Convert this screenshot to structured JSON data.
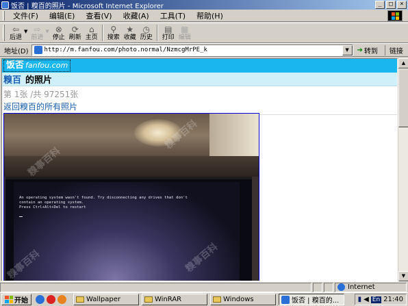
{
  "window": {
    "title": "饭否 | 糗百的照片 - Microsoft Internet Explorer",
    "minimize": "_",
    "maximize": "□",
    "close": "×"
  },
  "menu": {
    "items": [
      "文件(F)",
      "编辑(E)",
      "查看(V)",
      "收藏(A)",
      "工具(T)",
      "帮助(H)"
    ]
  },
  "toolbar": {
    "buttons": [
      {
        "label": "后退",
        "enabled": true
      },
      {
        "label": "前进",
        "enabled": false
      },
      {
        "label": "停止",
        "enabled": true
      },
      {
        "label": "刷新",
        "enabled": true
      },
      {
        "label": "主页",
        "enabled": true
      },
      {
        "label": "搜索",
        "enabled": true
      },
      {
        "label": "收藏",
        "enabled": true
      },
      {
        "label": "历史",
        "enabled": true
      },
      {
        "label": "打印",
        "enabled": true
      },
      {
        "label": "编辑",
        "enabled": false
      }
    ]
  },
  "address": {
    "label": "地址(D)",
    "url": "http://m.fanfou.com/photo.normal/NzmcgMrPE_k",
    "go_label": "转到",
    "links_label": "链接"
  },
  "page": {
    "logo_cn": "饭否",
    "logo_en": "fanfou.com",
    "user_name": "糗百",
    "photo_suffix": "的照片",
    "counter": "第 1张 /共 97251张",
    "back_link": "返回糗百的所有照片",
    "screen_text": "An operating system wasn't found. Try disconnecting any drives that don't\ncontain an operating system.\nPress Ctrl+Alt+Del to restart",
    "header_color": "#19b6ef",
    "title_bar_color": "#cfeff9",
    "link_color": "#1a5fb4"
  },
  "status": {
    "zone": "Internet"
  },
  "taskbar": {
    "start_label": "开始",
    "tasks": [
      {
        "label": "Wallpaper",
        "active": false
      },
      {
        "label": "WinRAR",
        "active": false
      },
      {
        "label": "Windows",
        "active": false
      },
      {
        "label": "饭否 | 糗百的...",
        "active": true
      }
    ],
    "ime": "En",
    "clock": "21:40"
  }
}
